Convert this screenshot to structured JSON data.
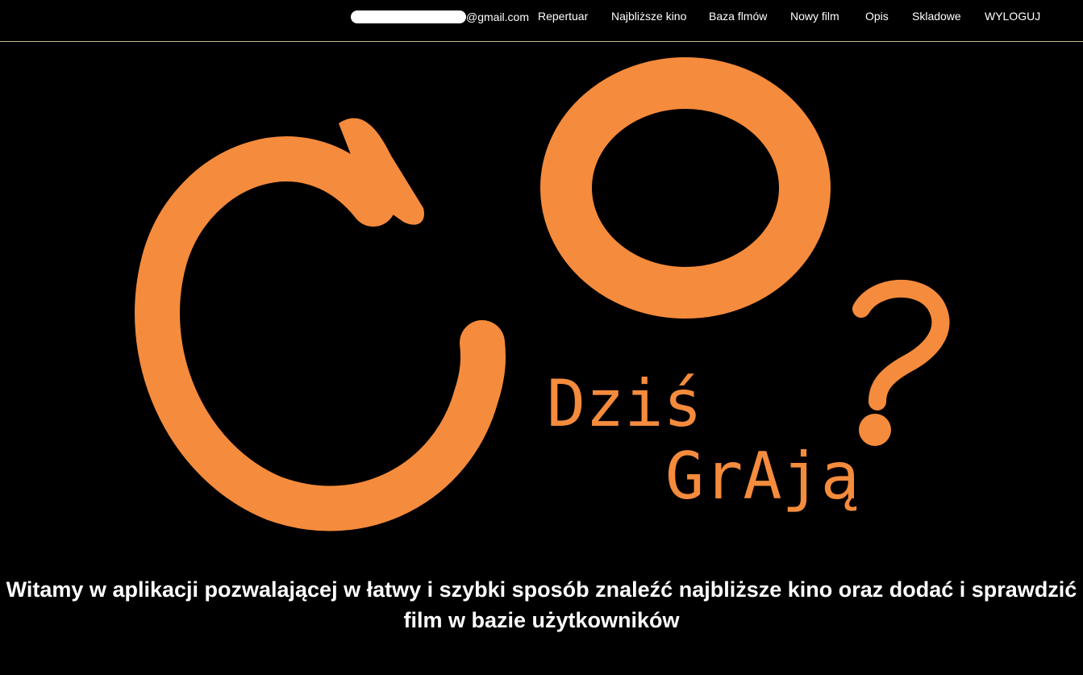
{
  "header": {
    "user_email_suffix": "@gmail.com",
    "nav": {
      "repertuar": "Repertuar",
      "najblizsze_kino": "Najbliższe kino",
      "baza_filmow": "Baza flmów",
      "nowy_film": "Nowy film",
      "opis": "Opis",
      "skladowe": "Skladowe",
      "wyloguj": "WYLOGUJ"
    }
  },
  "logo": {
    "line1": "Dziś",
    "line2": "GrAją",
    "color": "#f58b3c",
    "icon": "co-dzis-graja-logo"
  },
  "welcome": {
    "line1": "Witamy w aplikacji pozwalającej w łatwy i szybki sposób znaleźć najbliższe kino oraz dodać i sprawdzić",
    "line2": "film w bazie użytkowników"
  },
  "colors": {
    "background": "#000000",
    "accent": "#f58b3c",
    "text": "#ffffff"
  }
}
